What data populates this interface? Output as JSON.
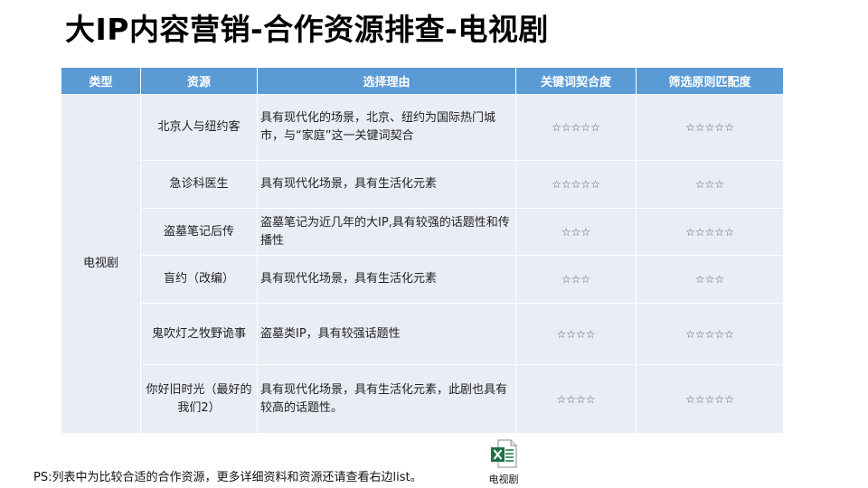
{
  "title": "大IP内容营销-合作资源排查-电视剧",
  "table": {
    "headers": [
      "类型",
      "资源",
      "选择理由",
      "关键词契合度",
      "筛选原则匹配度"
    ],
    "type_label": "电视剧",
    "rows": [
      {
        "resource": "北京人与纽约客",
        "reason": "具有现代化的场景，北京、纽约为国际热门城市，与“家庭”这一关键词契合",
        "keyword_fit": "☆☆☆☆☆",
        "criteria_fit": "☆☆☆☆☆"
      },
      {
        "resource": "急诊科医生",
        "reason": "具有现代化场景，具有生活化元素",
        "keyword_fit": "☆☆☆☆☆",
        "criteria_fit": "☆☆☆"
      },
      {
        "resource": "盗墓笔记后传",
        "reason": "盗墓笔记为近几年的大IP,具有较强的话题性和传播性",
        "keyword_fit": "☆☆☆",
        "criteria_fit": "☆☆☆☆☆"
      },
      {
        "resource": "盲约（改编）",
        "reason": "具有现代化场景，具有生活化元素",
        "keyword_fit": "☆☆☆",
        "criteria_fit": "☆☆☆"
      },
      {
        "resource": "鬼吹灯之牧野诡事",
        "reason": "盗墓类IP，具有较强话题性",
        "keyword_fit": "☆☆☆☆",
        "criteria_fit": "☆☆☆☆☆"
      },
      {
        "resource": "你好旧时光（最好的我们2）",
        "reason": "具有现代化场景，具有生活化元素，此剧也具有较高的话题性。",
        "keyword_fit": "☆☆☆☆",
        "criteria_fit": "☆☆☆☆☆"
      }
    ]
  },
  "footnote": "PS:列表中为比较合适的合作资源，更多详细资料和资源还请查看右边list。",
  "attachment": {
    "label": "电视剧",
    "icon": "excel-file-icon",
    "accent": "#1e7145"
  }
}
